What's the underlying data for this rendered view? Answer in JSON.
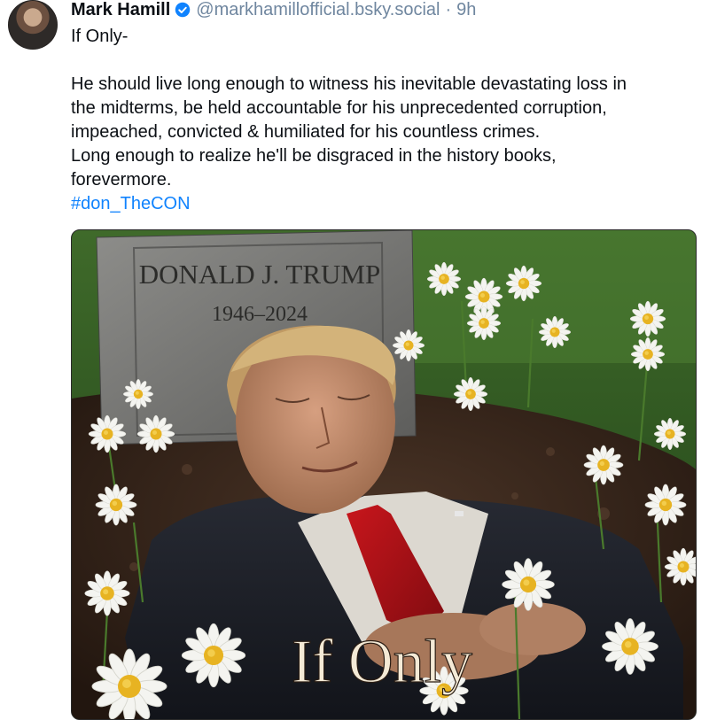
{
  "post": {
    "author": {
      "display_name": "Mark Hamill",
      "handle": "@markhamillofficial.bsky.social",
      "time": "9h",
      "separator": "·",
      "avatar_icon": "user-avatar",
      "verified_icon": "verified-badge-icon"
    },
    "text": {
      "line1": "If Only-",
      "line2": "He should live long enough to witness his inevitable devastating loss in",
      "line3": "the midterms, be held accountable for his unprecedented corruption,",
      "line4": "impeached, convicted & humiliated for his countless crimes.",
      "line5": "Long enough to realize he'll be disgraced in the history books,",
      "line6": "forevermore.",
      "hashtag": "#don_TheCON"
    },
    "image": {
      "headstone_name": "DONALD J. TRUMP",
      "headstone_dates": "1946–2024",
      "caption": "If Only"
    }
  },
  "colors": {
    "handle": "#6f869f",
    "hashtag": "#1083fe",
    "verified": "#1083fe",
    "text": "#0b0f14"
  }
}
